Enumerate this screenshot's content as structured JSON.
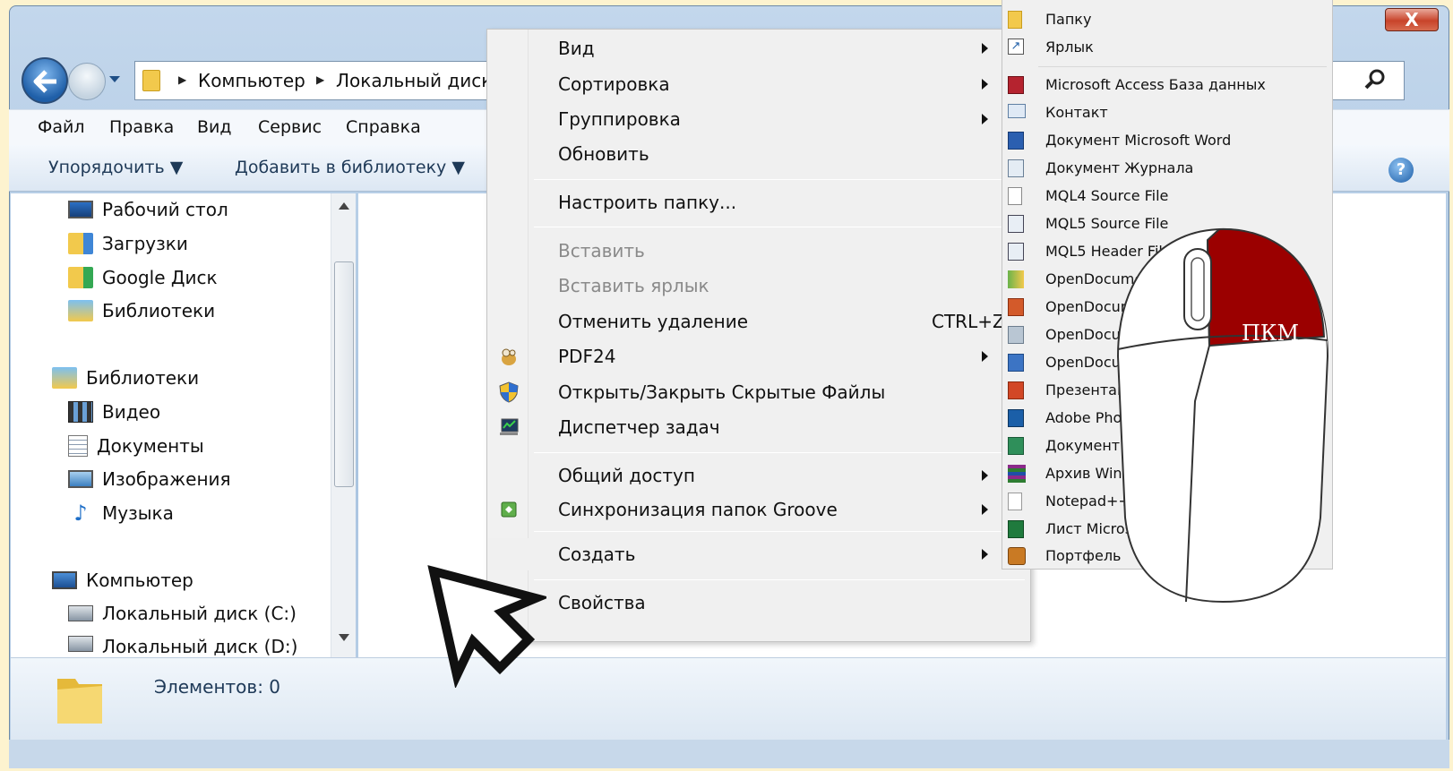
{
  "window": {
    "close_label": "X"
  },
  "address": {
    "crumbs": [
      "Компьютер",
      "Локальный диск"
    ]
  },
  "menubar": [
    "Файл",
    "Правка",
    "Вид",
    "Сервис",
    "Справка"
  ],
  "toolbar": {
    "organize": "Упорядочить ▼",
    "add_library": "Добавить в библиотеку ▼",
    "help": "?"
  },
  "nav": {
    "items": [
      {
        "label": "Рабочий стол",
        "icon": "desktop-icon"
      },
      {
        "label": "Загрузки",
        "icon": "downloads-icon"
      },
      {
        "label": "Google Диск",
        "icon": "google-drive-icon"
      },
      {
        "label": "Библиотеки",
        "icon": "libraries-icon"
      },
      {
        "label": "Библиотеки",
        "icon": "libraries-icon"
      },
      {
        "label": "Видео",
        "icon": "video-icon"
      },
      {
        "label": "Документы",
        "icon": "documents-icon"
      },
      {
        "label": "Изображения",
        "icon": "images-icon"
      },
      {
        "label": "Музыка",
        "icon": "music-icon"
      },
      {
        "label": "Компьютер",
        "icon": "computer-icon"
      },
      {
        "label": "Локальный диск (C:)",
        "icon": "drive-icon"
      },
      {
        "label": "Локальный диск (D:)",
        "icon": "drive-icon"
      }
    ]
  },
  "details": {
    "count": "Элементов: 0"
  },
  "context_menu": {
    "items": [
      {
        "label": "Вид",
        "submenu": true
      },
      {
        "label": "Сортировка",
        "submenu": true
      },
      {
        "label": "Группировка",
        "submenu": true
      },
      {
        "label": "Обновить"
      },
      {
        "label": "Настроить папку..."
      },
      {
        "label": "Вставить",
        "disabled": true
      },
      {
        "label": "Вставить ярлык",
        "disabled": true
      },
      {
        "label": "Отменить удаление",
        "shortcut": "CTRL+Z"
      },
      {
        "label": "PDF24",
        "submenu": true,
        "icon": "pdf24-icon"
      },
      {
        "label": "Открыть/Закрыть Скрытые Файлы",
        "icon": "shield-icon"
      },
      {
        "label": "Диспетчер задач",
        "icon": "task-manager-icon"
      },
      {
        "label": "Общий доступ",
        "submenu": true
      },
      {
        "label": "Синхронизация папок Groove",
        "submenu": true,
        "icon": "groove-icon"
      },
      {
        "label": "Создать",
        "submenu": true
      },
      {
        "label": "Свойства"
      }
    ]
  },
  "submenu": {
    "items": [
      {
        "label": "Папку",
        "icon": "folder-icon"
      },
      {
        "label": "Ярлык",
        "icon": "shortcut-icon"
      },
      {
        "label": "Microsoft Access База данных",
        "icon": "access-icon"
      },
      {
        "label": "Контакт",
        "icon": "contact-icon"
      },
      {
        "label": "Документ Microsoft Word",
        "icon": "word-icon"
      },
      {
        "label": "Документ Журнала",
        "icon": "journal-icon"
      },
      {
        "label": "MQL4 Source File",
        "icon": "mql-icon"
      },
      {
        "label": "MQL5 Source File",
        "icon": "mql-icon"
      },
      {
        "label": "MQL5 Header File",
        "icon": "mql-icon"
      },
      {
        "label": "OpenDocument",
        "icon": "odf-icon"
      },
      {
        "label": "OpenDocument",
        "icon": "odp-icon"
      },
      {
        "label": "OpenDocument",
        "icon": "odg-icon"
      },
      {
        "label": "OpenDocument",
        "icon": "odt-icon"
      },
      {
        "label": "Презентация",
        "icon": "powerpoint-icon"
      },
      {
        "label": "Adobe Photoshop",
        "icon": "photoshop-icon"
      },
      {
        "label": "Документ",
        "icon": "publisher-icon"
      },
      {
        "label": "Архив WinRAR",
        "icon": "winrar-icon"
      },
      {
        "label": "Notepad++",
        "icon": "notepad-icon"
      },
      {
        "label": "Лист Microsoft Excel",
        "icon": "excel-icon"
      },
      {
        "label": "Портфель",
        "icon": "briefcase-icon"
      }
    ]
  },
  "mouse_overlay": {
    "label": "ПКМ",
    "accent": "#9b0000"
  },
  "colors": {
    "accent": "#1f5fa8",
    "background": "#fdf3cf"
  }
}
